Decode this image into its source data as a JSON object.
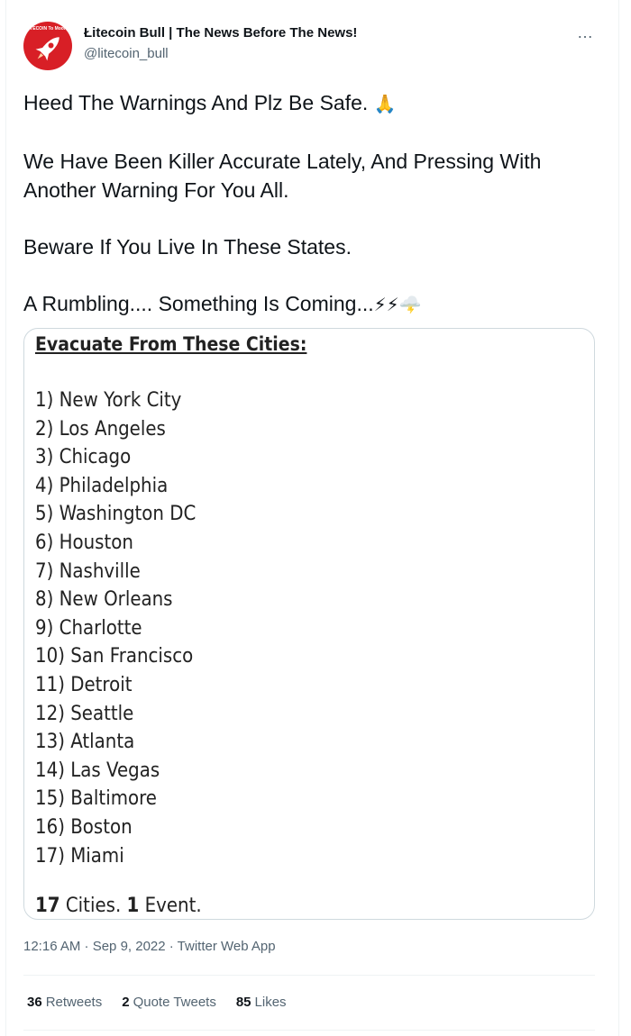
{
  "author": {
    "display_name": "Łitecoin Bull | The News Before The News!",
    "handle": "@litecoin_bull",
    "avatar_text": "LITECOIN To Moon!!",
    "avatar_icon": "rocket-icon"
  },
  "more_icon": "…",
  "tweet": {
    "line1": "Heed The Warnings And Plz Be Safe.",
    "line1_emoji": "🙏",
    "line2": "We Have Been Killer Accurate Lately, And Pressing With Another Warning For You All.",
    "line3": "Beware If You Live In These States.",
    "line4": "A Rumbling.... Something Is Coming...",
    "line4_emoji": "⚡⚡🌩️"
  },
  "media": {
    "title": "Evacuate From These Cities:",
    "cities": [
      "1) New York City",
      "2) Los Angeles",
      "3) Chicago",
      "4) Philadelphia",
      "5) Washington DC",
      "6) Houston",
      "7) Nashville",
      "8) New Orleans",
      "9) Charlotte",
      "10) San Francisco",
      "11) Detroit",
      "12) Seattle",
      "13) Atlanta",
      "14) Las Vegas",
      "15) Baltimore",
      "16) Boston",
      "17) Miami"
    ],
    "summary_num1": "17",
    "summary_text1": " Cities. ",
    "summary_num2": "1",
    "summary_text2": " Event."
  },
  "meta": {
    "timestamp": "12:16 AM · Sep 9, 2022 · Twitter Web App"
  },
  "stats": {
    "retweets_count": "36",
    "retweets_label": "Retweets",
    "quotes_count": "2",
    "quotes_label": "Quote Tweets",
    "likes_count": "85",
    "likes_label": "Likes"
  },
  "colors": {
    "avatar_bg": "#d81f26",
    "text_primary": "#0f1419",
    "text_secondary": "#536471",
    "border": "#cfd9de"
  }
}
